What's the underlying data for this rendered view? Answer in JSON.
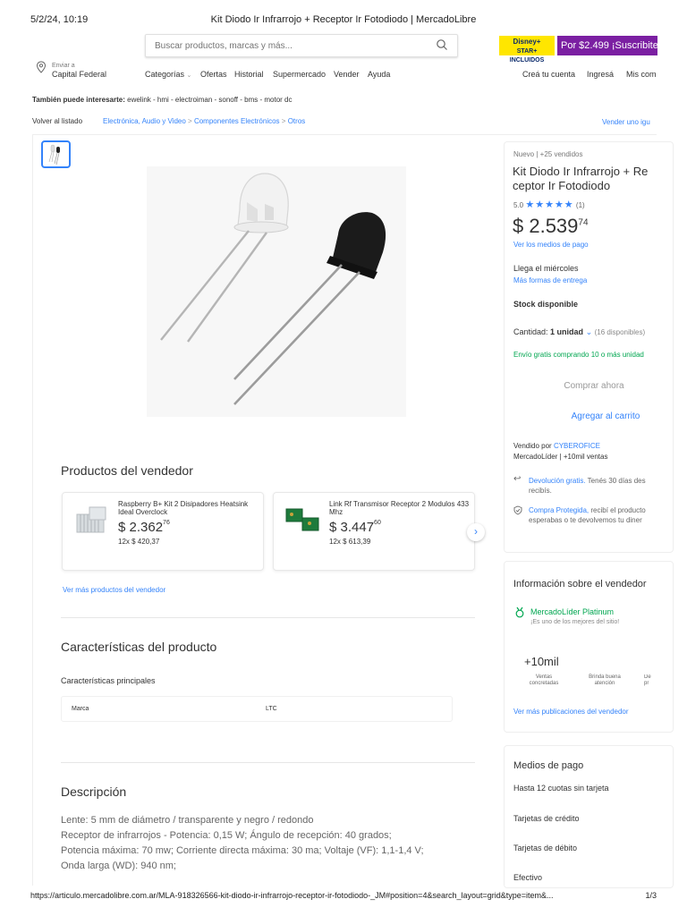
{
  "print_header": {
    "date": "5/2/24, 10:19",
    "title": "Kit Diodo Ir Infrarrojo + Receptor Ir Fotodiodo | MercadoLibre"
  },
  "header": {
    "search_placeholder": "Buscar productos, marcas y más...",
    "disney_label": "STAR+ INCLUIDOS",
    "promo_text": "Por $2.499 ¡Suscribite",
    "location_small": "Enviar a",
    "location_big": "Capital Federal",
    "nav": [
      "Categorías",
      "Ofertas",
      "Historial",
      "Supermercado",
      "Vender",
      "Ayuda"
    ],
    "account": [
      "Creá tu cuenta",
      "Ingresá",
      "Mis com"
    ]
  },
  "interest": {
    "label": "También puede interesarte:",
    "items": "ewelink - hmi - electroiman - sonoff - bms - motor dc"
  },
  "breadcrumb": {
    "back": "Volver al listado",
    "path": [
      "Electrónica, Audio y Video",
      "Componentes Electrónicos",
      "Otros"
    ],
    "sell": "Vender uno igu"
  },
  "product": {
    "condition": "Nuevo  |  +25 vendidos",
    "title_line1": "Kit Diodo Ir Infrarrojo + Re",
    "title_line2": "ceptor Ir Fotodiodo",
    "rating": "5.0",
    "reviews": "(1)",
    "price_main": "$ 2.539",
    "price_cents": "74",
    "payment_link": "Ver los medios de pago",
    "delivery": "Llega el miércoles",
    "delivery_link": "Más formas de entrega",
    "stock": "Stock disponible",
    "qty_label": "Cantidad:",
    "qty_value": "1 unidad",
    "qty_available": "(16 disponibles)",
    "free_shipping": "Envío gratis comprando 10 o más unidad",
    "buy_now": "Comprar ahora",
    "add_cart": "Agregar al carrito",
    "seller_prefix": "Vendido por",
    "seller": "CYBEROFICE",
    "seller_stats": "MercadoLíder  |  +10mil ventas",
    "return_title": "Devolución gratis.",
    "return_text": "Tenés 30 días des",
    "return_text2": "recibís.",
    "protect_title": "Compra Protegida,",
    "protect_text": "recibí el producto",
    "protect_text2": "esperabas o te devolvemos tu diner"
  },
  "seller_products": {
    "title": "Productos del vendedor",
    "items": [
      {
        "title": "Raspberry B+ Kit 2 Disipadores Heatsink Ideal Overclock",
        "price": "$ 2.362",
        "cents": "76",
        "installments": "12x $ 420,37"
      },
      {
        "title": "Link Rf Transmisor Receptor 2 Modulos 433 Mhz",
        "price": "$ 3.447",
        "cents": "60",
        "installments": "12x $ 613,39"
      }
    ],
    "more": "Ver más productos del vendedor"
  },
  "characteristics": {
    "title": "Características del producto",
    "subtitle": "Características principales",
    "rows": [
      {
        "key": "Marca",
        "value": "LTC"
      }
    ]
  },
  "description": {
    "title": "Descripción",
    "lines": [
      "Lente: 5 mm de diámetro / transparente y negro / redondo",
      "Receptor de infrarrojos - Potencia: 0,15 W; Ángulo de recepción: 40 grados;",
      "Potencia máxima: 70 mw; Corriente directa máxima: 30 ma; Voltaje (VF): 1,1-1,4 V;",
      "Onda larga (WD): 940 nm;"
    ]
  },
  "seller_info": {
    "title": "Información sobre el vendedor",
    "level": "MercadoLíder Platinum",
    "level_sub": "¡Es uno de los mejores del sitio!",
    "sales": "+10mil",
    "sales_label": "Ventas concretadas",
    "attention_label": "Brinda buena atención",
    "third_label": "De pr",
    "more": "Ver más publicaciones del vendedor"
  },
  "payment": {
    "title": "Medios de pago",
    "items": [
      "Hasta 12 cuotas sin tarjeta",
      "Tarjetas de crédito",
      "Tarjetas de débito",
      "Efectivo"
    ]
  },
  "footer": {
    "url": "https://articulo.mercadolibre.com.ar/MLA-918326566-kit-diodo-ir-infrarrojo-receptor-ir-fotodiodo-_JM#position=4&search_layout=grid&type=item&...",
    "page": "1/3"
  },
  "colors": {
    "link": "#3483fa",
    "green": "#00a650",
    "yellow": "#ffe600",
    "promo": "#7b1fa2"
  }
}
